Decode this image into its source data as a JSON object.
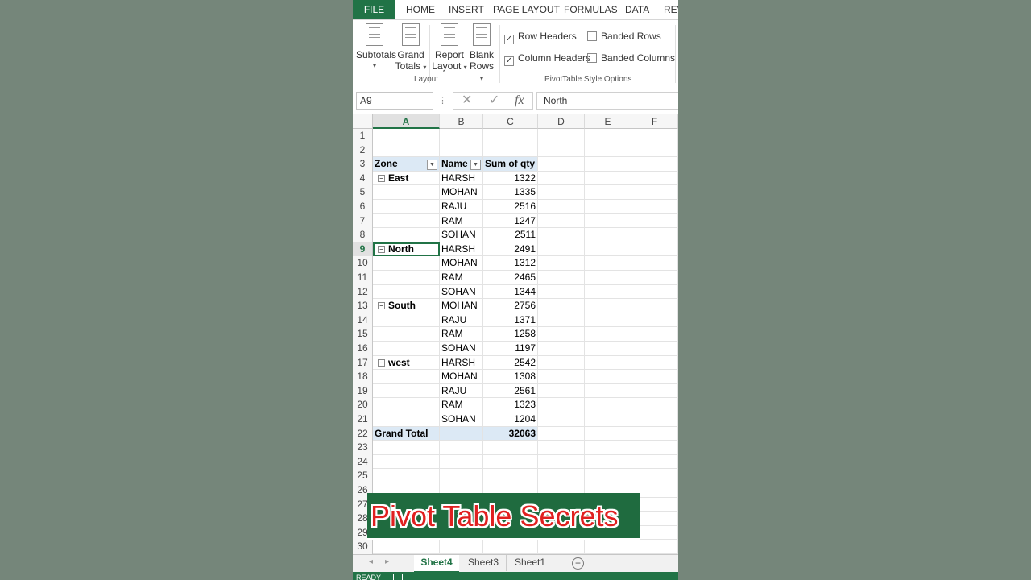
{
  "ribbon_tabs": [
    "FILE",
    "HOME",
    "INSERT",
    "PAGE LAYOUT",
    "FORMULAS",
    "DATA",
    "REV"
  ],
  "ribbon": {
    "layout_buttons": [
      {
        "line1": "Subtotals",
        "line2": "",
        "caret": "▾"
      },
      {
        "line1": "Grand",
        "line2": "Totals",
        "caret": "▾"
      },
      {
        "line1": "Report",
        "line2": "Layout",
        "caret": "▾"
      },
      {
        "line1": "Blank",
        "line2": "Rows",
        "caret": "▾"
      }
    ],
    "layout_group_label": "Layout",
    "style_options": [
      {
        "label": "Row Headers",
        "checked": true
      },
      {
        "label": "Banded Rows",
        "checked": false
      },
      {
        "label": "Column Headers",
        "checked": true
      },
      {
        "label": "Banded Columns",
        "checked": false
      }
    ],
    "style_group_label": "PivotTable Style Options"
  },
  "formula_bar": {
    "name_box": "A9",
    "dots": "⋮",
    "cancel": "✕",
    "enter": "✓",
    "fx": "fx",
    "content": "North"
  },
  "columns": [
    "A",
    "B",
    "C",
    "D",
    "E",
    "F"
  ],
  "selected_column": "A",
  "selected_row": 9,
  "pivot": {
    "headers": {
      "zone": "Zone",
      "name": "Name",
      "sum": "Sum of qty"
    },
    "rows": [
      {
        "row": 4,
        "zone": "East",
        "name": "HARSH",
        "qty": "1322"
      },
      {
        "row": 5,
        "zone": "",
        "name": "MOHAN",
        "qty": "1335"
      },
      {
        "row": 6,
        "zone": "",
        "name": "RAJU",
        "qty": "2516"
      },
      {
        "row": 7,
        "zone": "",
        "name": "RAM",
        "qty": "1247"
      },
      {
        "row": 8,
        "zone": "",
        "name": "SOHAN",
        "qty": "2511"
      },
      {
        "row": 9,
        "zone": "North",
        "name": "HARSH",
        "qty": "2491"
      },
      {
        "row": 10,
        "zone": "",
        "name": "MOHAN",
        "qty": "1312"
      },
      {
        "row": 11,
        "zone": "",
        "name": "RAM",
        "qty": "2465"
      },
      {
        "row": 12,
        "zone": "",
        "name": "SOHAN",
        "qty": "1344"
      },
      {
        "row": 13,
        "zone": "South",
        "name": "MOHAN",
        "qty": "2756"
      },
      {
        "row": 14,
        "zone": "",
        "name": "RAJU",
        "qty": "1371"
      },
      {
        "row": 15,
        "zone": "",
        "name": "RAM",
        "qty": "1258"
      },
      {
        "row": 16,
        "zone": "",
        "name": "SOHAN",
        "qty": "1197"
      },
      {
        "row": 17,
        "zone": "west",
        "name": "HARSH",
        "qty": "2542"
      },
      {
        "row": 18,
        "zone": "",
        "name": "MOHAN",
        "qty": "1308"
      },
      {
        "row": 19,
        "zone": "",
        "name": "RAJU",
        "qty": "2561"
      },
      {
        "row": 20,
        "zone": "",
        "name": "RAM",
        "qty": "1323"
      },
      {
        "row": 21,
        "zone": "",
        "name": "SOHAN",
        "qty": "1204"
      }
    ],
    "grand_total_label": "Grand Total",
    "grand_total_value": "32063"
  },
  "row_count": 30,
  "sheet_tabs": [
    {
      "label": "Sheet4",
      "active": true
    },
    {
      "label": "Sheet3",
      "active": false
    },
    {
      "label": "Sheet1",
      "active": false
    }
  ],
  "add_sheet": "+",
  "status": "READY",
  "overlay_title": "Pivot Table Secrets",
  "colors": {
    "excel_green": "#217346",
    "pivot_header_fill": "#dce9f5",
    "banner_bg": "#1f6b3f",
    "banner_text": "#e02020"
  }
}
